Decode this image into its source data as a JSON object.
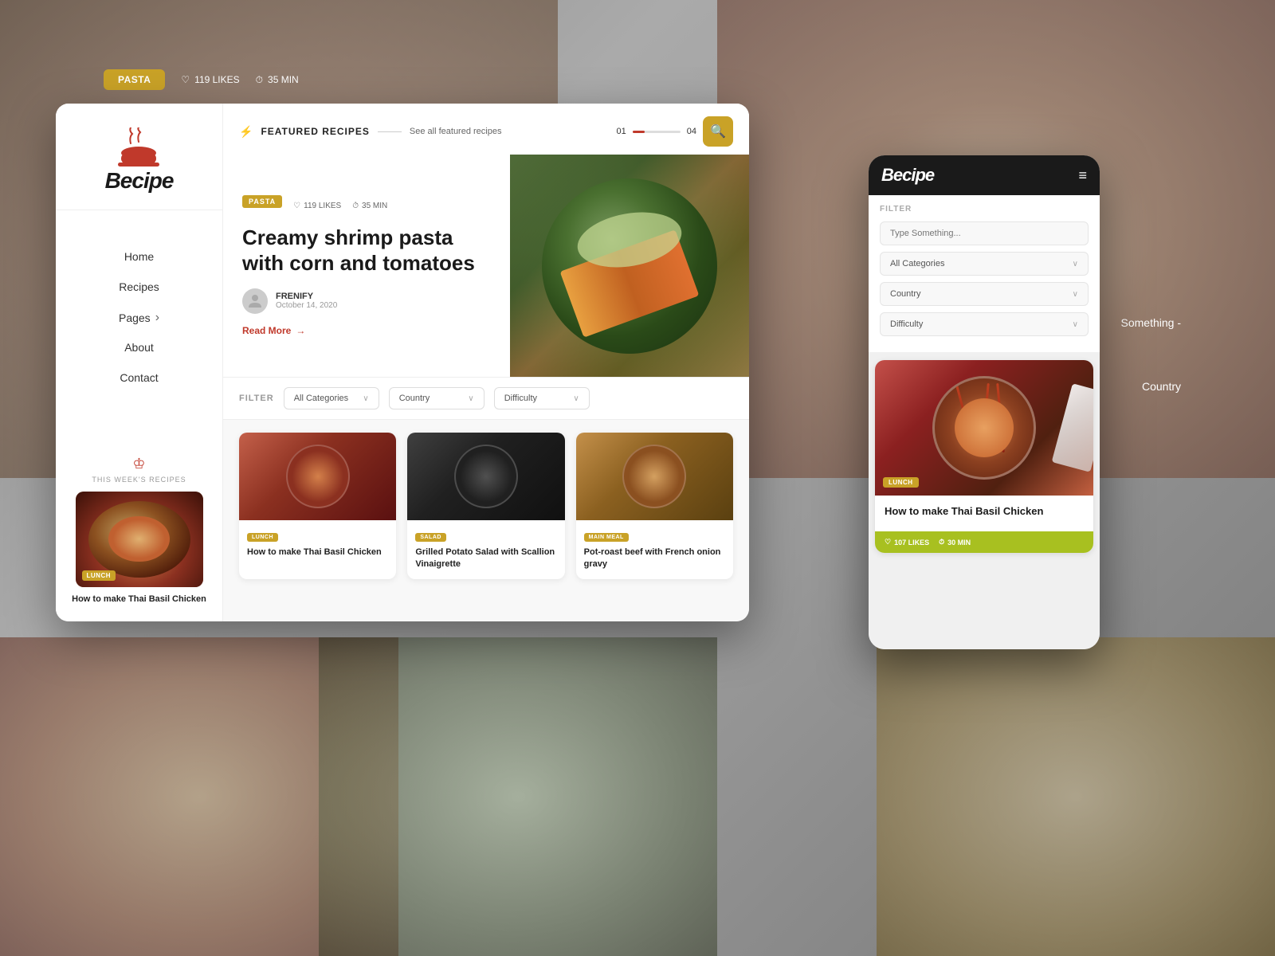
{
  "app": {
    "name": "Becipe"
  },
  "background": {
    "overlay": "rgba(160,150,140,0.7)"
  },
  "top_bar": {
    "tag": "PASTA",
    "likes_icon": "♡",
    "likes_count": "119 LIKES",
    "time_icon": "⏱",
    "time": "35 MIN"
  },
  "right_labels": {
    "something": "Something -",
    "country_top": "Country",
    "country_filter": "Country"
  },
  "sidebar": {
    "logo_text": "Becipe",
    "nav_items": [
      {
        "label": "Home",
        "has_arrow": false
      },
      {
        "label": "Recipes",
        "has_arrow": false
      },
      {
        "label": "Pages",
        "has_arrow": true
      },
      {
        "label": "About",
        "has_arrow": false
      },
      {
        "label": "Contact",
        "has_arrow": false
      }
    ],
    "weeks_label": "THIS WEEK'S RECIPES",
    "recipe_badge": "LUNCH",
    "recipe_title": "How to make Thai Basil Chicken"
  },
  "featured": {
    "section_title": "FEATURED RECIPES",
    "see_all": "See all featured recipes",
    "page_current": "01",
    "page_total": "04",
    "hero": {
      "tag": "PASTA",
      "likes": "119 LIKES",
      "time": "35 MIN",
      "title": "Creamy shrimp pasta with corn and tomatoes",
      "author": "FRENIFY",
      "date": "October 14, 2020",
      "read_more": "Read More"
    }
  },
  "filter": {
    "label": "FILTER",
    "categories_placeholder": "All Categories",
    "country_placeholder": "Country",
    "difficulty_placeholder": "Difficulty"
  },
  "recipe_cards": [
    {
      "tag": "LUNCH",
      "title": "How to make Thai Basil Chicken"
    },
    {
      "tag": "SALAD",
      "title": "Grilled Potato Salad with Scallion Vinaigrette"
    },
    {
      "tag": "MAIN MEAL",
      "title": "Pot-roast beef with French onion gravy"
    }
  ],
  "mobile": {
    "logo": "Becipe",
    "filter_title": "FILTER",
    "search_placeholder": "Type Something...",
    "selects": [
      {
        "label": "All Categories"
      },
      {
        "label": "Country"
      },
      {
        "label": "Difficulty"
      }
    ],
    "recipe": {
      "badge": "LUNCH",
      "title": "How to make Thai Basil Chicken",
      "likes": "107 LIKES",
      "time": "30 MIN"
    }
  },
  "icons": {
    "bolt": "⚡",
    "heart": "♡",
    "clock": "⏱",
    "search": "🔍",
    "arrow_right": "→",
    "chevron_down": "∨",
    "hamburger": "≡",
    "crown": "♔"
  }
}
